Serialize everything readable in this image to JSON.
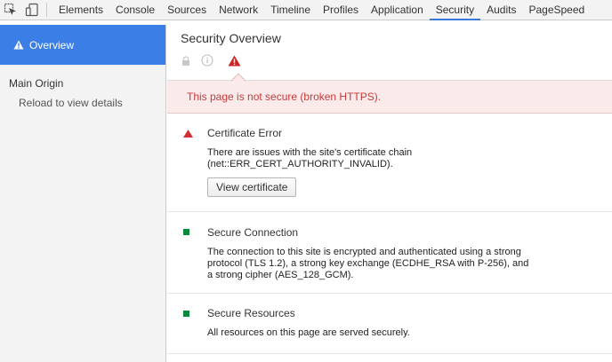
{
  "tabbar": {
    "tabs": [
      {
        "label": "Elements"
      },
      {
        "label": "Console"
      },
      {
        "label": "Sources"
      },
      {
        "label": "Network"
      },
      {
        "label": "Timeline"
      },
      {
        "label": "Profiles"
      },
      {
        "label": "Application"
      },
      {
        "label": "Security",
        "active": true
      },
      {
        "label": "Audits"
      },
      {
        "label": "PageSpeed"
      }
    ]
  },
  "sidebar": {
    "overview_label": "Overview",
    "origin_heading": "Main Origin",
    "reload_hint": "Reload to view details"
  },
  "overview": {
    "title": "Security Overview",
    "icons": [
      "lock-icon",
      "info-icon",
      "warning-icon"
    ],
    "banner": "This page is not secure (broken HTTPS)."
  },
  "sections": {
    "certificate": {
      "title": "Certificate Error",
      "desc_line1": "There are issues with the site's certificate chain",
      "desc_line2": "(net::ERR_CERT_AUTHORITY_INVALID).",
      "button_label": "View certificate",
      "status_color": "#d32f2f"
    },
    "connection": {
      "title": "Secure Connection",
      "desc_line1": "The connection to this site is encrypted and authenticated using a strong",
      "desc_line2": "protocol (TLS 1.2), a strong key exchange (ECDHE_RSA with P-256), and",
      "desc_line3": "a strong cipher (AES_128_GCM).",
      "status_color": "#0a8a3a"
    },
    "resources": {
      "title": "Secure Resources",
      "desc_line1": "All resources on this page are served securely.",
      "status_color": "#0a8a3a"
    }
  },
  "colors": {
    "accent": "#3b7fe6",
    "error_text": "#c53a3a",
    "banner_bg": "#fbeaea",
    "secure": "#0a8a3a"
  }
}
